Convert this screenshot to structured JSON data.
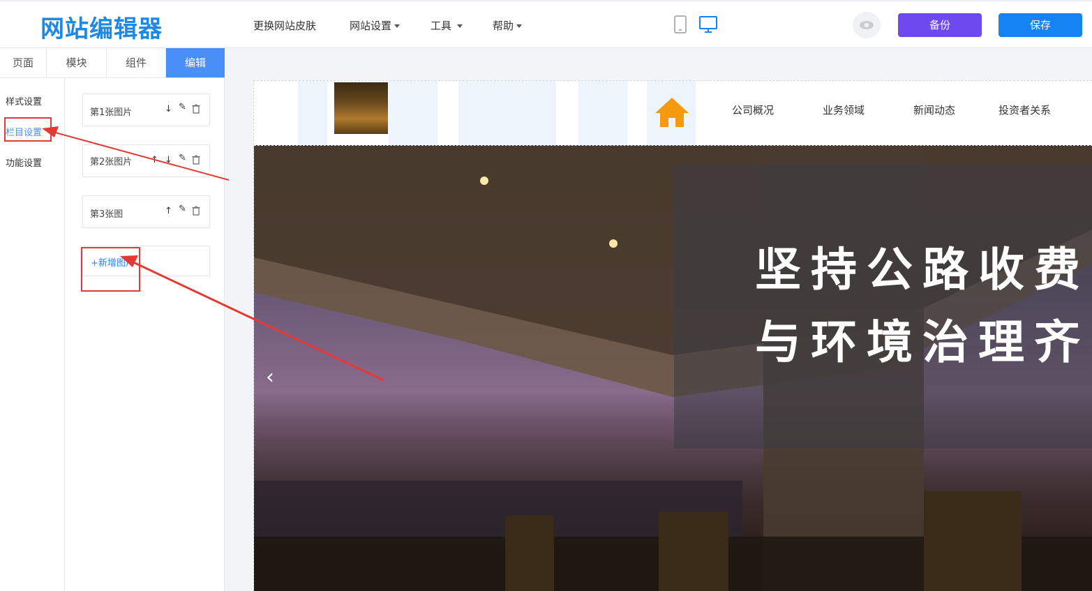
{
  "app": {
    "logo": "网站编辑器"
  },
  "menu": [
    {
      "label": "更换网站皮肤",
      "dropdown": false
    },
    {
      "label": "网站设置",
      "dropdown": true
    },
    {
      "label": "工具",
      "dropdown": true
    },
    {
      "label": "帮助",
      "dropdown": true
    }
  ],
  "toolbar": {
    "backup_label": "备份",
    "save_label": "保存",
    "preview_icon": "eye-icon",
    "mobile_icon": "phone-icon",
    "desktop_icon": "monitor-icon"
  },
  "tabs": [
    "页面",
    "模块",
    "组件",
    "编辑"
  ],
  "active_tab": "编辑",
  "subnav": [
    "样式设置",
    "栏目设置",
    "功能设置"
  ],
  "active_subnav": "栏目设置",
  "images": [
    {
      "label": "第1张图片",
      "icons": [
        "arrow-down-icon",
        "pencil-icon",
        "trash-icon"
      ]
    },
    {
      "label": "第2张图片",
      "icons": [
        "arrow-up-icon",
        "arrow-down-icon",
        "pencil-icon",
        "trash-icon"
      ]
    },
    {
      "label": "第3张图",
      "icons": [
        "arrow-up-icon",
        "pencil-icon",
        "trash-icon"
      ]
    }
  ],
  "add_image_label": "+新增图片",
  "site": {
    "nav": [
      "公司概况",
      "业务领域",
      "新闻动态",
      "投资者关系"
    ],
    "home_icon": "home-icon",
    "headline_line1": "坚持公路收费",
    "headline_line2": "与环境治理齐",
    "prev_arrow": "‹"
  },
  "colors": {
    "brand": "#1e88e5",
    "backup": "#6f49f0",
    "save": "#1683f5",
    "active_tab": "#4a8ff7",
    "annotation": "#e53935",
    "home": "#f59a0f"
  }
}
